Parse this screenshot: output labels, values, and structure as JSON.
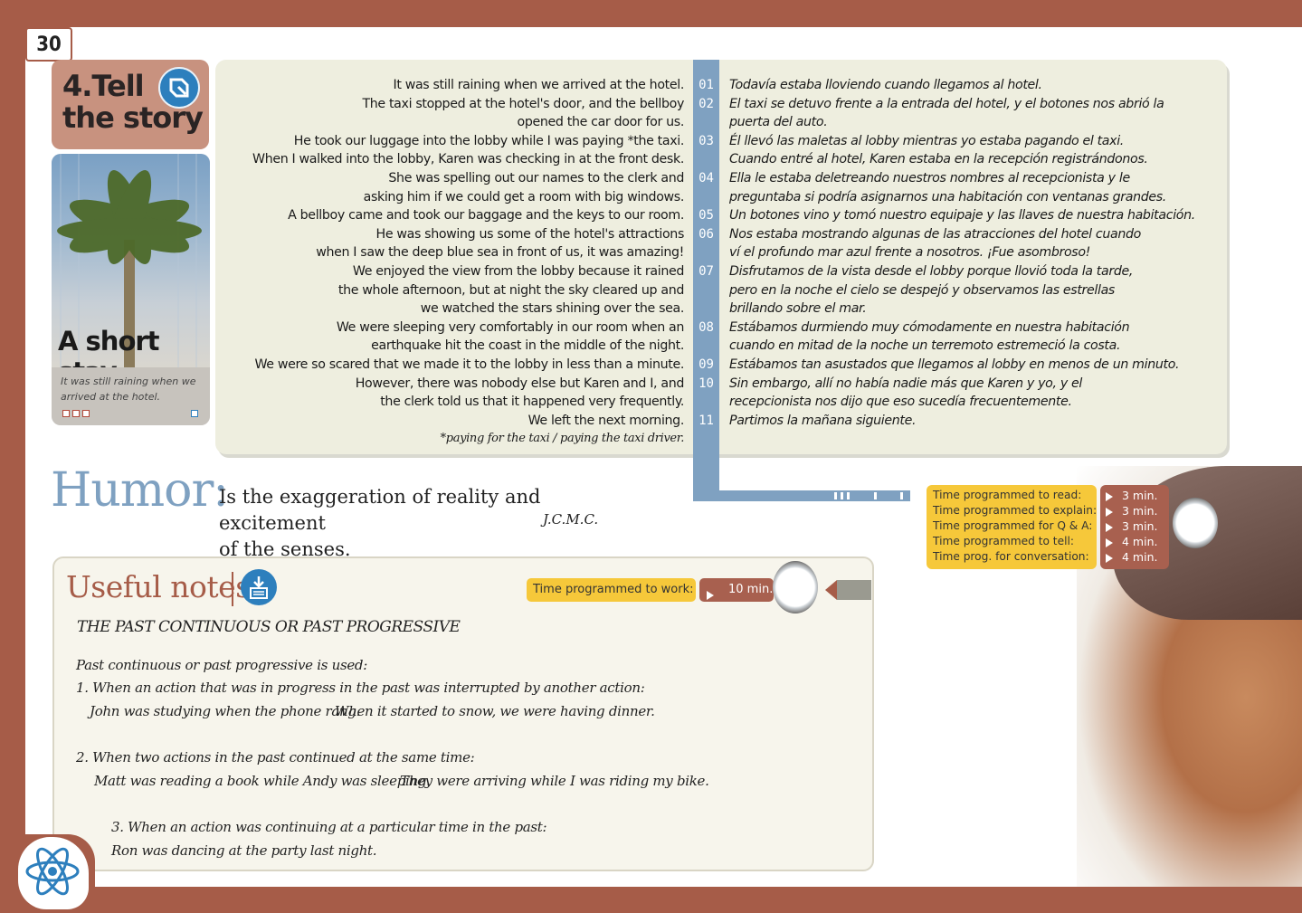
{
  "page_number": "30",
  "lesson": {
    "title_line1": "4.Tell",
    "title_line2": "the story",
    "photo_title": "A short stay",
    "photo_caption": "It was still raining when we arrived at the hotel."
  },
  "story": {
    "english": [
      "It was still raining when we arrived at the hotel.",
      "The taxi stopped at the hotel's door, and the bellboy",
      "opened the car door for us.",
      "He took our luggage into the lobby while I was paying *the taxi.",
      "When I walked into the lobby, Karen was checking in at the front desk.",
      "She was spelling out our names to the clerk and",
      "asking him if we could get a room with big windows.",
      "A bellboy came and took our baggage and the keys to our room.",
      "He was showing us some of the hotel's attractions",
      "when I saw the deep blue sea in front of us, it was amazing!",
      "We enjoyed the view from the lobby because it rained",
      "the whole afternoon, but at night the sky cleared up and",
      "we watched the stars shining over the sea.",
      "We were sleeping very comfortably in our room when an",
      "earthquake hit the coast in the middle of the night.",
      "We were so scared that we made it to the lobby in less than a minute.",
      "However, there was nobody else but Karen and I, and",
      "the clerk told us that it happened very frequently.",
      "We left the next morning."
    ],
    "footnote": "*paying for the taxi / paying the taxi driver.",
    "numbers": [
      "01",
      "02",
      "",
      "03",
      "",
      "04",
      "",
      "05",
      "06",
      "",
      "07",
      "",
      "",
      "08",
      "",
      "09",
      "10",
      "",
      "11"
    ],
    "spanish": [
      "Todavía estaba lloviendo cuando llegamos al hotel.",
      "El taxi se detuvo frente a la entrada del hotel, y el botones nos abrió la",
      "puerta del auto.",
      "Él llevó las maletas al lobby mientras yo estaba pagando el taxi.",
      "Cuando entré al hotel, Karen estaba en la recepción registrándonos.",
      "Ella le estaba deletreando nuestros nombres al recepcionista y le",
      "preguntaba si podría asignarnos una habitación con ventanas grandes.",
      "Un botones vino y tomó nuestro equipaje y las llaves de nuestra habitación.",
      "Nos estaba mostrando algunas de las atracciones del hotel cuando",
      "ví el profundo mar azul frente a nosotros. ¡Fue asombroso!",
      "Disfrutamos de la vista desde el lobby porque llovió toda la tarde,",
      "pero en la noche el cielo se despejó y observamos las estrellas",
      "brillando sobre el mar.",
      "Estábamos durmiendo muy cómodamente en nuestra habitación",
      "cuando en mitad de la noche un terremoto estremeció la costa.",
      "Estábamos tan asustados que llegamos al lobby en menos de un minuto.",
      "Sin embargo, allí no había nadie más que Karen y yo, y el",
      "recepcionista nos dijo que eso sucedía frecuentemente.",
      "Partimos la mañana siguiente."
    ]
  },
  "humor": {
    "heading": "Humor:",
    "line1": "Is the exaggeration of reality and excitement",
    "line2": "of the senses.",
    "author": "J.C.M.C."
  },
  "times": {
    "labels": [
      "Time programmed to read:",
      "Time programmed to explain:",
      "Time programmed for Q & A:",
      "Time programmed to tell:",
      "Time prog. for conversation:"
    ],
    "values": [
      "3 min.",
      "3 min.",
      "3 min.",
      "4 min.",
      "4 min."
    ]
  },
  "notes": {
    "heading": "Useful notes",
    "work_label": "Time programmed to work:",
    "work_value": "10 min.",
    "subheading": "THE PAST CONTINUOUS OR PAST PROGRESSIVE",
    "intro": "Past continuous or past progressive is used:",
    "rule1": "1. When an  action that was in progress in the past was interrupted by another action:",
    "ex1a": "John was studying when the phone rang.",
    "ex1b": "When it started to snow, we were having dinner.",
    "rule2": "2. When two actions in the past continued at the same time:",
    "ex2a": "Matt was reading a book while Andy was sleeping.",
    "ex2b": "They were arriving while I was riding my bike.",
    "rule3": "3. When an action was continuing at a particular time in the past:",
    "ex3": "Ron was dancing at the party last night."
  },
  "colors": {
    "frame": "#a65c48",
    "accent_blue": "#7fa1c1",
    "icon_blue": "#2d7fbd",
    "yellow": "#f6c83a",
    "panel": "#eeeedf"
  }
}
